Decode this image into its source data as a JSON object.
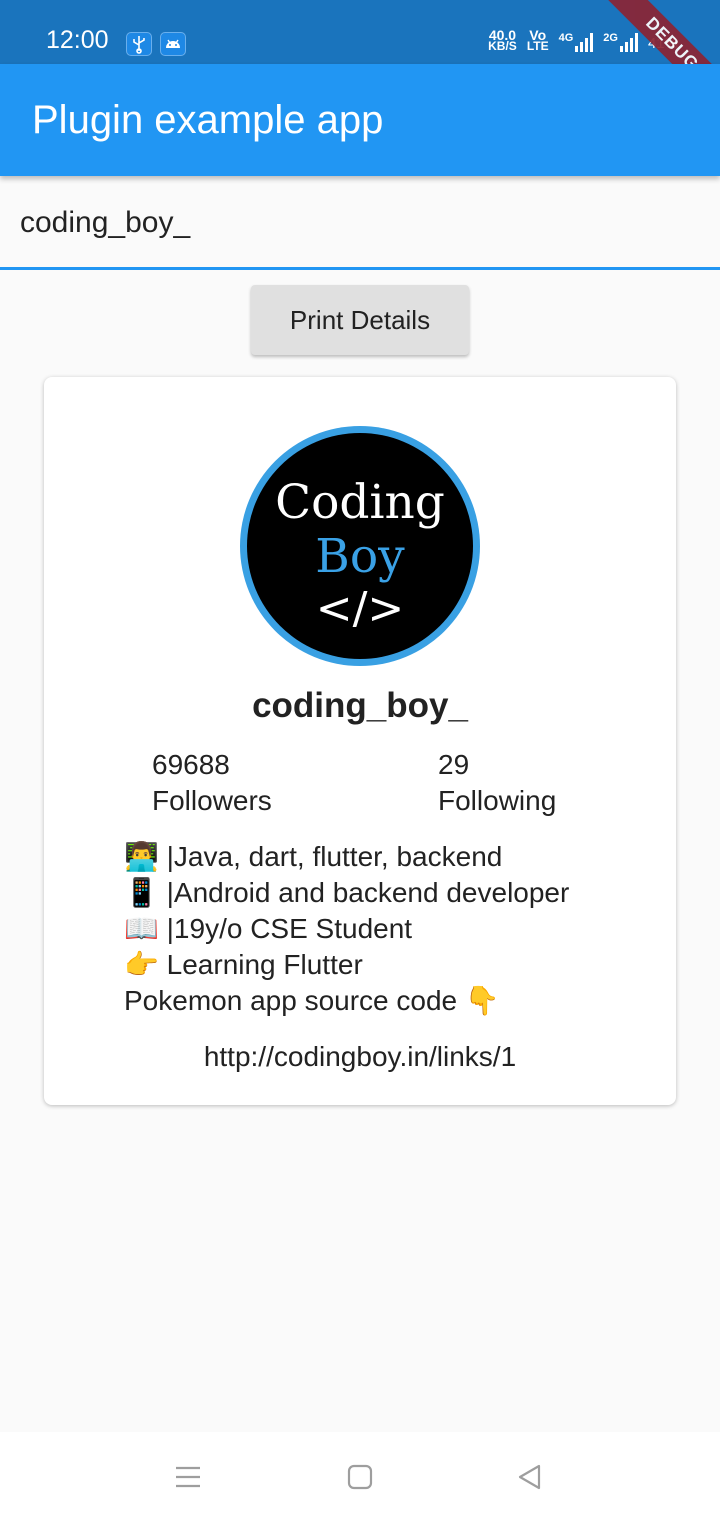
{
  "status_bar": {
    "time": "12:00",
    "speed_value": "40.0",
    "speed_unit": "KB/S",
    "volte_top": "Vo",
    "volte_bottom": "LTE",
    "net_4g": "4G",
    "net_2g": "2G",
    "battery": "41%",
    "icons": [
      "usb-icon",
      "android-icon",
      "signal-icon",
      "battery-icon"
    ]
  },
  "debug_banner": "DEBUG",
  "app_bar": {
    "title": "Plugin example app",
    "color": "#2196f3"
  },
  "search": {
    "value": "coding_boy_"
  },
  "print_button": {
    "label": "Print Details"
  },
  "profile": {
    "logo": {
      "line1": "Coding",
      "line2": "Boy",
      "code": "</>"
    },
    "username": "coding_boy_",
    "followers_count": "69688",
    "followers_label": "Followers",
    "following_count": "29",
    "following_label": "Following",
    "bio": [
      {
        "emoji": "👨‍💻",
        "text": " |Java, dart, flutter, backend"
      },
      {
        "emoji": "📱",
        "text": " |Android and backend developer"
      },
      {
        "emoji": "📖",
        "text": " |19y/o CSE Student"
      },
      {
        "emoji": "👉",
        "text": " Learning Flutter"
      },
      {
        "emoji": "👇",
        "text": "Pokemon app source code "
      }
    ],
    "link": "http://codingboy.in/links/1"
  },
  "nav_bar": {
    "icons": [
      "menu-icon",
      "home-icon",
      "back-icon"
    ]
  }
}
